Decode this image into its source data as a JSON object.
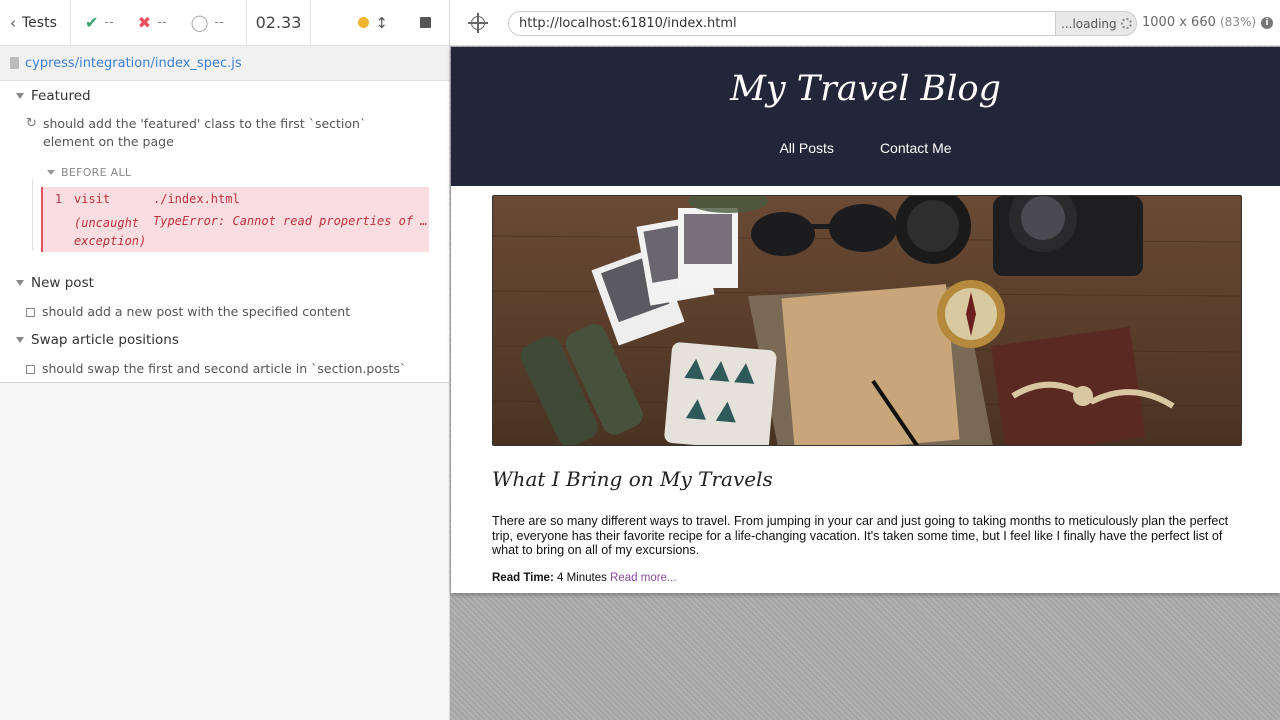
{
  "reporter": {
    "tests_label": "Tests",
    "stats": {
      "passed": "--",
      "failed": "--",
      "pending": "--"
    },
    "duration": "02.33",
    "spec_path": "cypress/integration/index_spec.js",
    "suites": [
      {
        "title": "Featured",
        "tests": [
          {
            "title": "should add the 'featured' class to the first `section` element on the page",
            "state": "running"
          }
        ]
      },
      {
        "title": "New post",
        "tests": [
          {
            "title": "should add a new post with the specified content",
            "state": "pending"
          }
        ]
      },
      {
        "title": "Swap article positions",
        "tests": [
          {
            "title": "should swap the first and second article in `section.posts`",
            "state": "pending"
          }
        ]
      }
    ],
    "hook": {
      "label": "BEFORE ALL",
      "command": {
        "number": "1",
        "name": "visit",
        "message": "./index.html",
        "error_name": "(uncaught exception)",
        "error_message": "TypeError: Cannot read properties of undefined"
      }
    }
  },
  "aut": {
    "url": "http://localhost:61810/index.html",
    "loading_label": "...loading",
    "viewport": "1000 x 660",
    "scale": "(83%)",
    "page": {
      "blog_title": "My Travel Blog",
      "nav": [
        "All Posts",
        "Contact Me"
      ],
      "post": {
        "title": "What I Bring on My Travels",
        "body": "There are so many different ways to travel. From jumping in your car and just going to taking months to meticulously plan the perfect trip, everyone has their favorite recipe for a life-changing vacation. It's taken some time, but I feel like I finally have the perfect list of what to bring on all of my excursions.",
        "read_time_label": "Read Time:",
        "read_time_value": "4 Minutes",
        "read_more": "Read more..."
      }
    }
  },
  "colors": {
    "pass": "#37a56e",
    "fail": "#e94f5f",
    "running": "#f0b332",
    "blog_header_bg": "#222639",
    "link": "#3b7fd0"
  }
}
